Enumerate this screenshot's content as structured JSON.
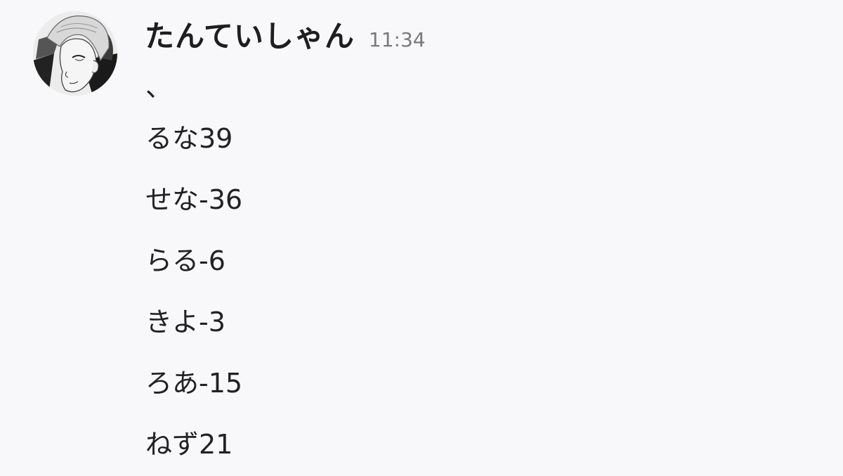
{
  "message": {
    "avatar": "avatar-portrait",
    "username": "たんていしゃん",
    "timestamp": "11:34",
    "lines": [
      "、",
      "るな39",
      "せな-36",
      "らる-6",
      "きよ-3",
      "ろあ-15",
      "ねず21"
    ]
  },
  "colors": {
    "background": "#f8f8fa",
    "username": "#1e1e1e",
    "timestamp": "#7a7a7a",
    "text": "#222222"
  }
}
